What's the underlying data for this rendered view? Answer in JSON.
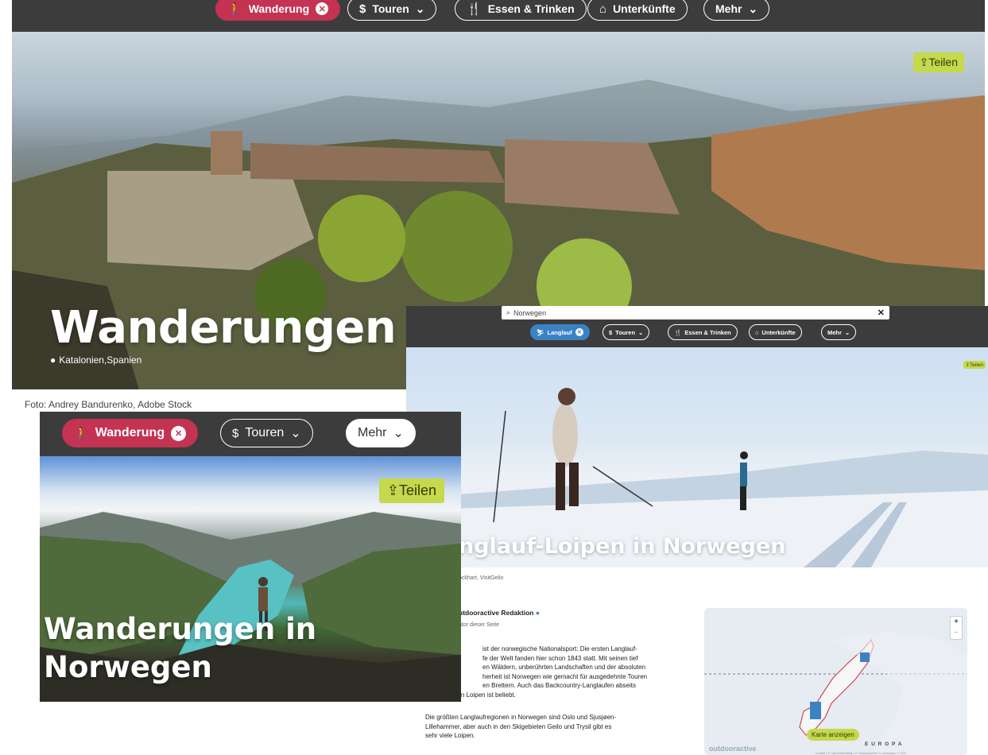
{
  "panelA": {
    "nav": {
      "active_label": "Wanderung",
      "tours_label": "Touren",
      "food_label": "Essen & Trinken",
      "lodging_label": "Unterkünfte",
      "more_label": "Mehr"
    },
    "share_label": "Teilen",
    "title": "Wanderungen in d",
    "location": "Katalonien,Spanien",
    "credit": "Foto: Andrey Bandurenko, Adobe Stock"
  },
  "panelB": {
    "search_value": "Norwegen",
    "nav": {
      "active_label": "Langlauf",
      "tours_label": "Touren",
      "food_label": "Essen & Trinken",
      "lodging_label": "Unterkünfte",
      "more_label": "Mehr"
    },
    "share_label": "Teilen",
    "title": "nglauf-Loipen in Norwegen",
    "photo_credit": "ockhart, VisitGeilo",
    "author_name": "utdooractive Redaktion",
    "author_role": "ator dieser Seite",
    "paragraph1_lines": [
      "ist der norwegische Nationalsport: Die ersten Langlauf-",
      "fe der Welt fanden hier schon 1843 statt. Mit seinen tief",
      "en Wäldern, unberührten Landschaften und der absoluten",
      "herheit ist Norwegen wie gemacht für ausgedehnte Touren",
      "en Brettern. Auch das Backcountry-Langlaufen abseits",
      "der gespurten Loipen ist beliebt."
    ],
    "paragraph2_lines": [
      "Die größten Langlaufregionen in Norwegen sind Oslo und Sjusjøen-",
      "Lillehammer, aber auch in den Skigebieten Geilo und Trysil gibt es",
      "sehr viele Loipen."
    ],
    "map": {
      "zoom_in": "+",
      "zoom_out": "−",
      "button_label": "Karte anzeigen",
      "region_label": "E U R O P A",
      "watermark": "outdooractive",
      "attribution": "Leaflet | © OpenStreetMap, © Outdooractive © swisstopo © IGN"
    }
  },
  "panelC": {
    "nav": {
      "active_label": "Wanderung",
      "tours_label": "Touren",
      "more_label": "Mehr"
    },
    "share_label": "Teilen",
    "title_line1": "Wanderungen in",
    "title_line2": "Norwegen"
  },
  "colors": {
    "nav_bg": "#3c3c3c",
    "hike_accent": "#c43352",
    "ski_accent": "#3b82c4",
    "share_bg": "#c6d84b"
  }
}
